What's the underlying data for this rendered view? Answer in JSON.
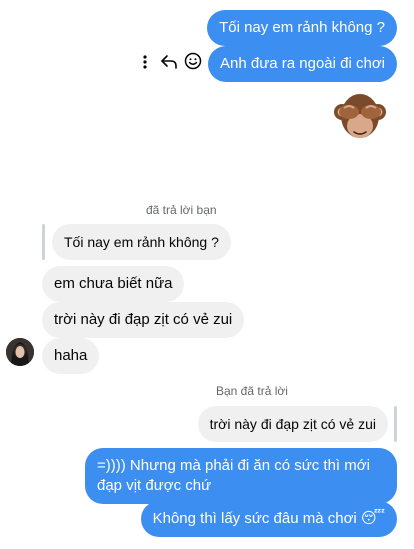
{
  "messages": {
    "out1": "Tối nay em rảnh không ?",
    "out2": "Anh đưa ra ngoài đi chơi",
    "reply_meta_in": "đã trả lời bạn",
    "quoted_in": "Tối nay em rảnh không ?",
    "in1": "em chưa biết nữa",
    "in2": "trời này đi đạp zịt có vẻ zui",
    "in3": "haha",
    "reply_meta_out": "Bạn đã trả lời",
    "quoted_out": "trời này đi đạp zịt có vẻ zui",
    "out3_line1": "=)))) Nhưng mà phải đi ăn có sức thì mới",
    "out3_line2": "đạp vịt được chứ",
    "out4": "Không thì lấy sức đâu mà chơi",
    "out4_emoji": "😴"
  },
  "icons": {
    "more": "more-vertical-icon",
    "reply": "reply-arrow-icon",
    "react": "smiley-react-icon",
    "sticker": "see-no-evil-monkey-sticker"
  }
}
